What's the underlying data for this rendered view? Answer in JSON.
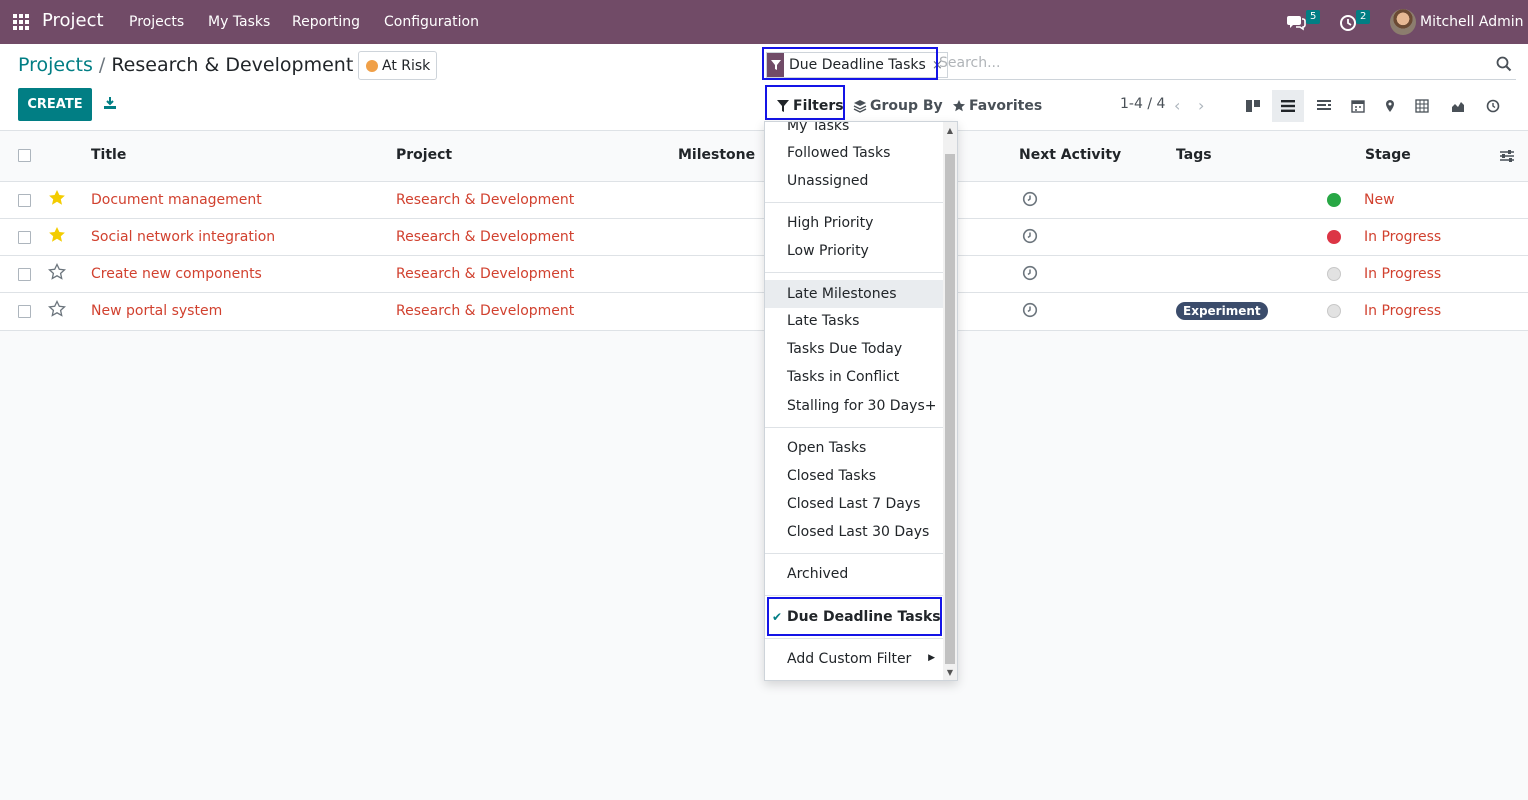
{
  "navbar": {
    "brand": "Project",
    "menus": [
      "Projects",
      "My Tasks",
      "Reporting",
      "Configuration"
    ],
    "messages_count": "5",
    "activities_count": "2",
    "user_name": "Mitchell Admin"
  },
  "breadcrumb": {
    "parent": "Projects",
    "separator": "/",
    "current": "Research & Development"
  },
  "project_status": "At Risk",
  "toolbar": {
    "create_label": "CREATE"
  },
  "search": {
    "facet_label": "Due Deadline Tasks",
    "facet_remove": "×",
    "placeholder": "Search..."
  },
  "search_options": {
    "filters_label": "Filters",
    "group_by_label": "Group By",
    "favorites_label": "Favorites"
  },
  "pager": {
    "value": "1-4 / 4"
  },
  "table": {
    "columns": [
      "Title",
      "Project",
      "Milestone",
      "Next Activity",
      "Tags",
      "Stage"
    ],
    "rows": [
      {
        "title": "Document management",
        "project": "Research & Development",
        "starred": true,
        "tag": "",
        "state": "green",
        "stage": "New"
      },
      {
        "title": "Social network integration",
        "project": "Research & Development",
        "starred": true,
        "tag": "",
        "state": "red",
        "stage": "In Progress"
      },
      {
        "title": "Create new components",
        "project": "Research & Development",
        "starred": false,
        "tag": "",
        "state": "grey",
        "stage": "In Progress"
      },
      {
        "title": "New portal system",
        "project": "Research & Development",
        "starred": false,
        "tag": "Experiment",
        "state": "grey",
        "stage": "In Progress"
      }
    ]
  },
  "filters_menu": {
    "group1": [
      "My Tasks",
      "Followed Tasks",
      "Unassigned"
    ],
    "group2": [
      "High Priority",
      "Low Priority"
    ],
    "group3": [
      "Late Milestones",
      "Late Tasks",
      "Tasks Due Today",
      "Tasks in Conflict",
      "Stalling for 30 Days+"
    ],
    "group4": [
      "Open Tasks",
      "Closed Tasks",
      "Closed Last 7 Days",
      "Closed Last 30 Days"
    ],
    "group5": [
      "Archived"
    ],
    "group6": [
      "Due Deadline Tasks"
    ],
    "custom": "Add Custom Filter",
    "hovered_item": "Late Milestones",
    "checked_item": "Due Deadline Tasks"
  },
  "colors": {
    "brand": "#714b67",
    "accent": "#017e84",
    "link_red": "#d1412f",
    "highlight": "#1414e6",
    "state_green": "#28a745",
    "state_red": "#dc3545",
    "state_grey": "#e2e2e2"
  }
}
